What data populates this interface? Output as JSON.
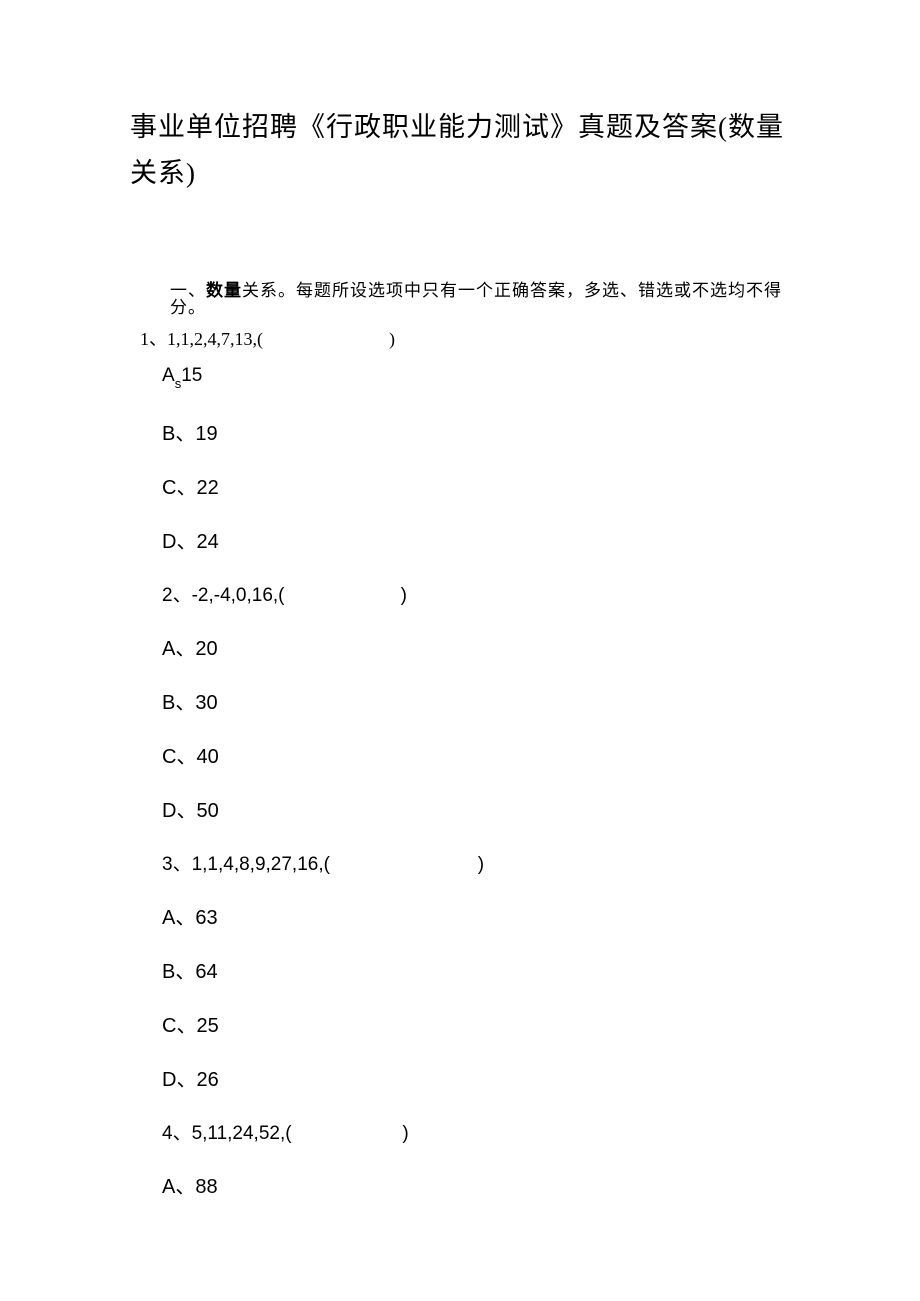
{
  "title": "事业单位招聘《行政职业能力测试》真题及答案(数量关系)",
  "section_intro_prefix": "一、",
  "section_intro_bold": "数量",
  "section_intro_rest": "关系。每题所设选项中只有一个正确答案，多选、错选或不选均不得分。",
  "q1": {
    "stem": "1、1,1,2,4,7,13,(                            )",
    "optA_prefix": "A",
    "optA_sub": "s",
    "optA_val": "15",
    "optB": "B、19",
    "optC": "C、22",
    "optD": "D、24"
  },
  "q2": {
    "stem": "2、-2,-4,0,16,(                      )",
    "optA": "A、20",
    "optB": "B、30",
    "optC": "C、40",
    "optD": "D、50"
  },
  "q3": {
    "stem": "3、1,1,4,8,9,27,16,(                            )",
    "optA": "A、63",
    "optB": "B、64",
    "optC": "C、25",
    "optD": "D、26"
  },
  "q4": {
    "stem": "4、5,11,24,52,(                     )",
    "optA": "A、88"
  }
}
